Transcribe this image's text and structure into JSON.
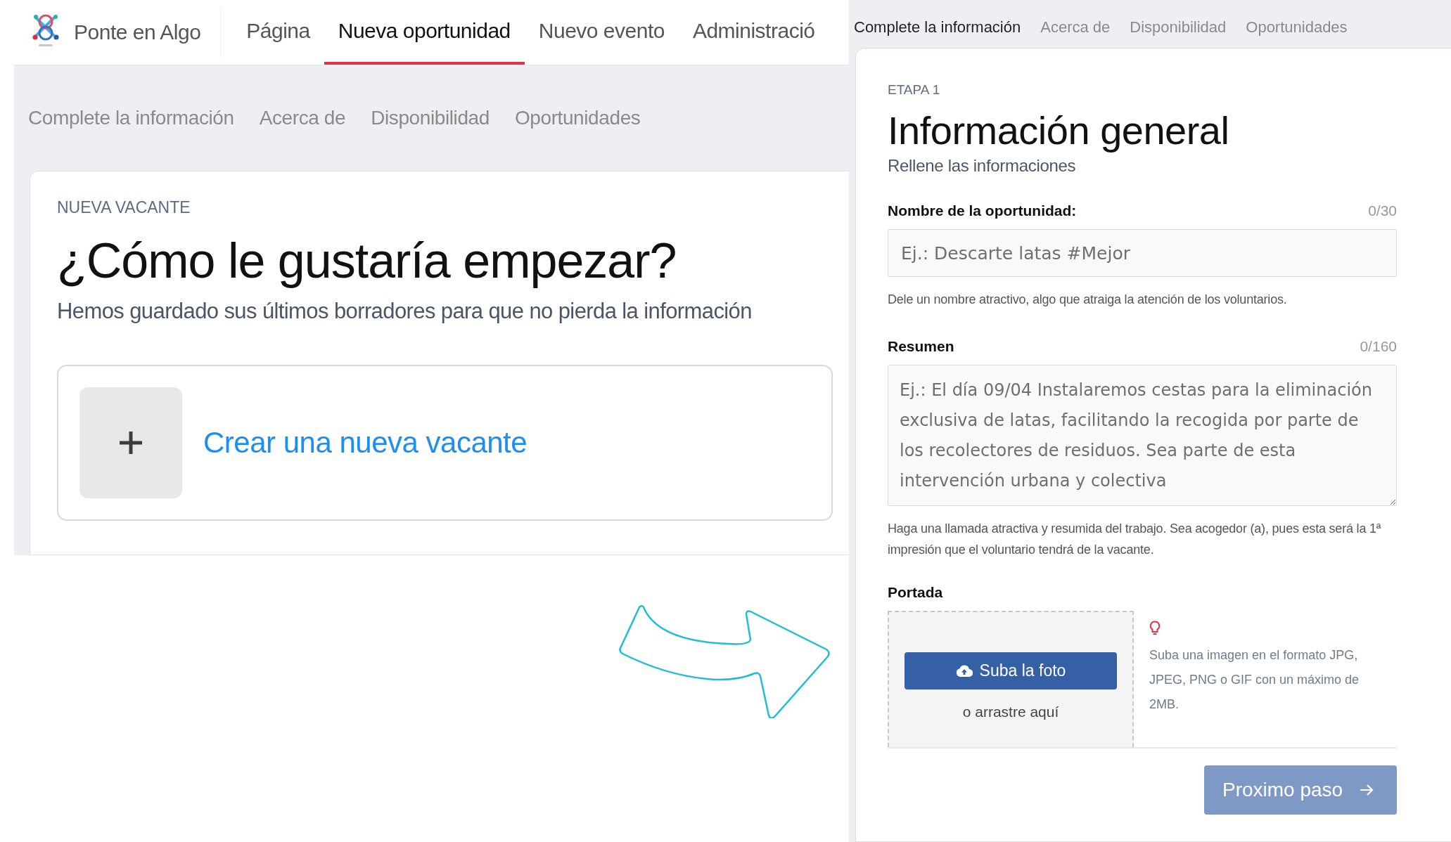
{
  "left_screen": {
    "app": {
      "name": "Ponte en Algo"
    },
    "nav_tabs": [
      {
        "label": "Página",
        "selected": false
      },
      {
        "label": "Nueva oportunidad",
        "selected": true
      },
      {
        "label": "Nuevo evento",
        "selected": false
      },
      {
        "label": "Administració",
        "selected": false
      }
    ],
    "step_tabs": [
      {
        "label": "Complete la información",
        "selected": false
      },
      {
        "label": "Acerca de",
        "selected": false
      },
      {
        "label": "Disponibilidad",
        "selected": false
      },
      {
        "label": "Oportunidades",
        "selected": false
      }
    ],
    "card": {
      "eyebrow": "NUEVA VACANTE",
      "title": "¿Cómo le gustaría empezar?",
      "subtitle": "Hemos guardado sus últimos borradores para que no pierda la información",
      "create_option": "Crear una nueva vacante"
    }
  },
  "right_screen": {
    "step_tabs": [
      {
        "label": "Complete la información",
        "selected": true
      },
      {
        "label": "Acerca de",
        "selected": false
      },
      {
        "label": "Disponibilidad",
        "selected": false
      },
      {
        "label": "Oportunidades",
        "selected": false
      }
    ],
    "form": {
      "eyebrow": "ETAPA 1",
      "title": "Información general",
      "subtitle": "Rellene las informaciones",
      "fields": [
        {
          "kind": "input",
          "label": "Nombre de la oportunidad:",
          "counter": "0/30",
          "placeholder": "Ej.: Descarte latas #Mejor",
          "help": "Dele un nombre atractivo, algo que atraiga la atención de los voluntarios."
        },
        {
          "kind": "textarea",
          "label": "Resumen",
          "counter": "0/160",
          "placeholder": "Ej.: El día 09/04 Instalaremos cestas para la eliminación exclusiva de latas, facilitando la recogida por parte de los recolectores de residuos. Sea parte de esta intervención urbana y colectiva",
          "help": "Haga una llamada atractiva y resumida del trabajo. Sea acogedor (a), pues esta será la 1ª impresión que el voluntario tendrá de la vacante."
        }
      ],
      "cover": {
        "label": "Portada",
        "upload_button": "Suba la foto",
        "drop_hint": "o arrastre aquí",
        "tip": "Suba una imagen en el formato JPG, JPEG, PNG o GIF con un máximo de 2MB."
      },
      "next_button": {
        "label": "Proximo paso",
        "disabled": true
      }
    }
  }
}
